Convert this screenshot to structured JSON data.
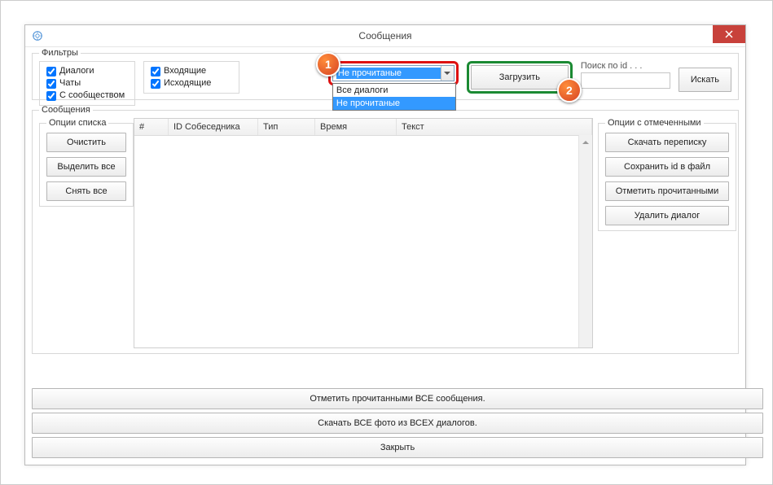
{
  "window": {
    "title": "Сообщения"
  },
  "filters": {
    "legend": "Фильтры",
    "cb_dialogs": "Диалоги",
    "cb_chats": "Чаты",
    "cb_community": "С сообществом",
    "cb_incoming": "Входящие",
    "cb_outgoing": "Исходящие",
    "dropdown_selected": "Не прочитаные",
    "dropdown_options": [
      "Все диалоги",
      "Не прочитаные"
    ],
    "load_btn": "Загрузить",
    "search_label": "Поиск по id . . .",
    "search_value": "",
    "search_btn": "Искать"
  },
  "messages": {
    "legend": "Сообщения",
    "list_opts_legend": "Опции списка",
    "clear_btn": "Очистить",
    "select_all_btn": "Выделить все",
    "deselect_all_btn": "Снять все",
    "columns": {
      "num": "#",
      "id": "ID Собеседника",
      "type": "Тип",
      "time": "Время",
      "text": "Текст"
    },
    "marked_opts_legend": "Опции с отмеченными",
    "download_conv_btn": "Скачать переписку",
    "save_id_btn": "Сохранить id в файл",
    "mark_read_btn": "Отметить прочитанными",
    "delete_dialog_btn": "Удалить диалог"
  },
  "bottom": {
    "mark_all_read": "Отметить прочитанными ВСЕ сообщения.",
    "download_photos": "Скачать ВСЕ фото из ВСЕХ диалогов.",
    "close": "Закрыть"
  },
  "steps": {
    "s1": "1",
    "s2": "2"
  }
}
